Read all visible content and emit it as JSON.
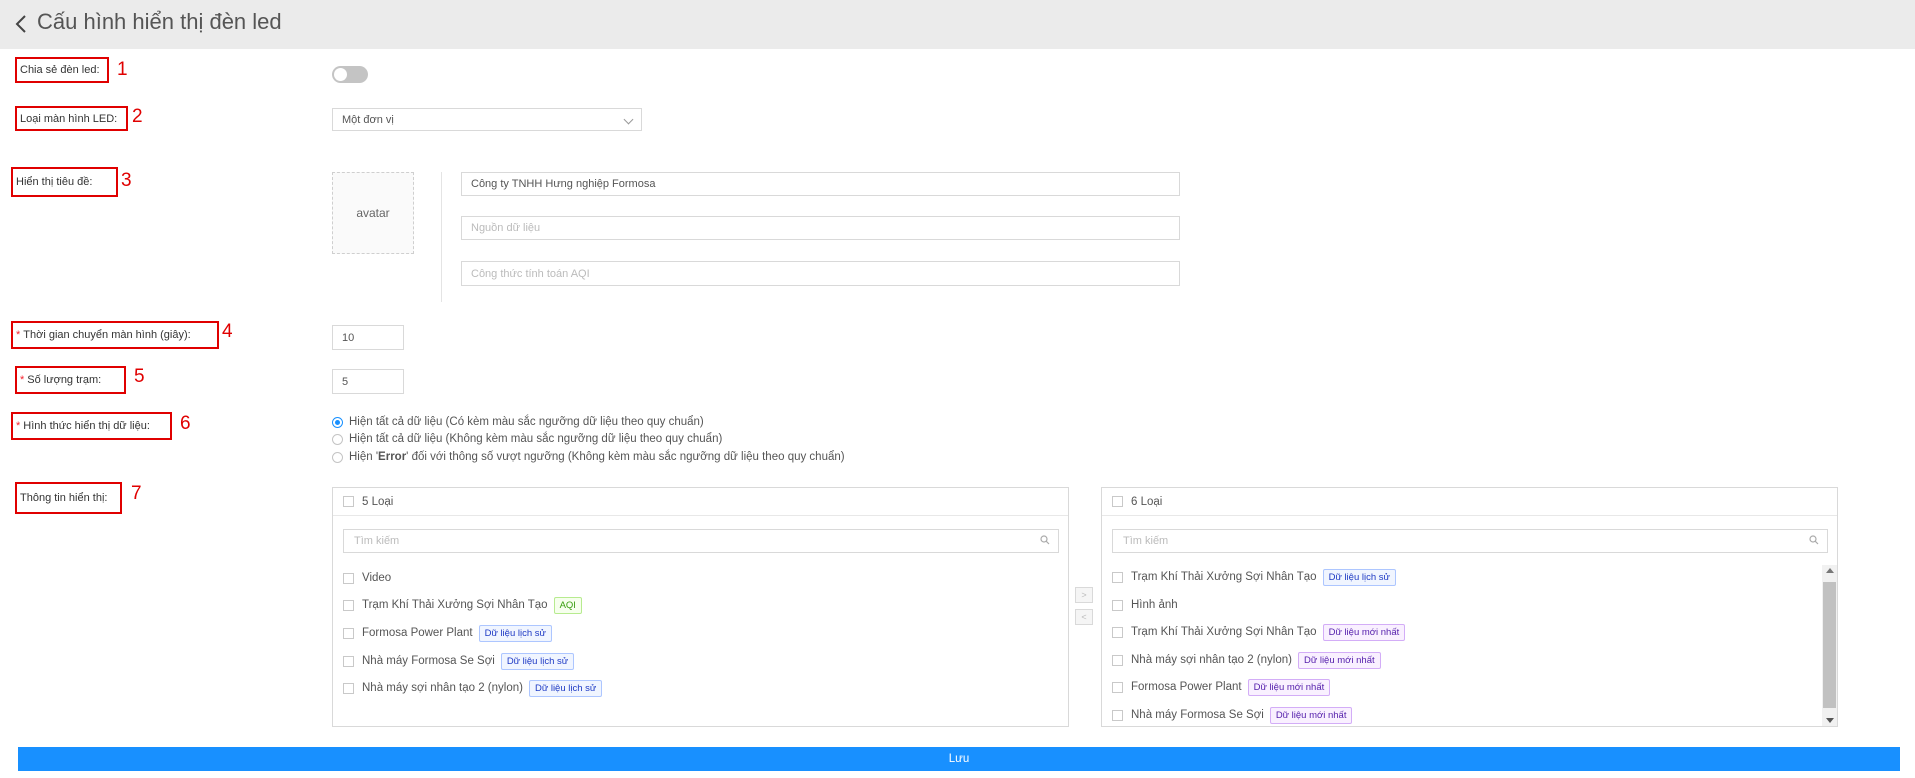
{
  "header": {
    "title": "Cấu hình hiển thị đèn led"
  },
  "form": {
    "share_led": {
      "label": "Chia sẻ đèn led",
      "number": "1",
      "enabled": false
    },
    "screen_type": {
      "label": "Loại màn hình LED",
      "number": "2",
      "value": "Một đơn vị"
    },
    "show_title": {
      "label": "Hiển thị tiêu đề",
      "number": "3",
      "avatar_alt": "avatar",
      "company_value": "Công ty TNHH Hưng nghiệp Formosa",
      "source_placeholder": "Nguồn dữ liệu",
      "aqi_placeholder": "Công thức tính toán AQI"
    },
    "switch_time": {
      "label": "Thời gian chuyển màn hình (giây)",
      "number": "4",
      "required": "*",
      "value": "10"
    },
    "station_count": {
      "label": "Số lượng trạm",
      "number": "5",
      "required": "*",
      "value": "5"
    },
    "display_mode": {
      "label": "Hình thức hiển thị dữ liệu",
      "number": "6",
      "required": "*",
      "options": [
        {
          "text": "Hiện tất cả dữ liệu (Có kèm màu sắc ngưỡng dữ liệu theo quy chuẩn)",
          "selected": true
        },
        {
          "text": "Hiện tất cả dữ liệu (Không kèm màu sắc ngưỡng dữ liệu theo quy chuẩn)",
          "selected": false
        },
        {
          "pre": "Hiện '",
          "bold": "Error",
          "post": "' đối với thông số vượt ngưỡng (Không kèm màu sắc ngưỡng dữ liệu theo quy chuẩn)",
          "selected": false
        }
      ]
    },
    "display_info": {
      "label": "Thông tin hiển thị",
      "number": "7"
    },
    "colon": ":"
  },
  "transfer": {
    "left": {
      "title": "5 Loại",
      "search_placeholder": "Tìm kiếm",
      "items": [
        {
          "name": "Video",
          "tag": ""
        },
        {
          "name": "Trạm Khí Thải Xưởng Sợi Nhân Tạo",
          "tag": "AQI",
          "tag_color": "green"
        },
        {
          "name": "Formosa Power Plant",
          "tag": "Dữ liệu lịch sử",
          "tag_color": "blue"
        },
        {
          "name": "Nhà máy Formosa Se Sợi",
          "tag": "Dữ liệu lịch sử",
          "tag_color": "blue"
        },
        {
          "name": "Nhà máy sợi nhân tạo 2 (nylon)",
          "tag": "Dữ liệu lịch sử",
          "tag_color": "blue"
        }
      ]
    },
    "right": {
      "title": "6 Loại",
      "search_placeholder": "Tìm kiếm",
      "items": [
        {
          "name": "Trạm Khí Thải Xưởng Sợi Nhân Tạo",
          "tag": "Dữ liệu lịch sử",
          "tag_color": "blue"
        },
        {
          "name": "Hình ảnh",
          "tag": ""
        },
        {
          "name": "Trạm Khí Thải Xưởng Sợi Nhân Tạo",
          "tag": "Dữ liệu mới nhất",
          "tag_color": "purple"
        },
        {
          "name": "Nhà máy sợi nhân tạo 2 (nylon)",
          "tag": "Dữ liệu mới nhất",
          "tag_color": "purple"
        },
        {
          "name": "Formosa Power Plant",
          "tag": "Dữ liệu mới nhất",
          "tag_color": "purple"
        },
        {
          "name": "Nhà máy Formosa Se Sợi",
          "tag": "Dữ liệu mới nhất",
          "tag_color": "purple"
        }
      ]
    },
    "move_right_glyph": ">",
    "move_left_glyph": "<"
  },
  "save_label": "Lưu",
  "colors": {
    "primary": "#1890ff",
    "annotation": "#e00000",
    "required": "#f5222d",
    "header_bg": "#ebebeb"
  },
  "icons": [
    "back-chevron-icon",
    "chevron-down-icon",
    "search-icon",
    "scroll-up-icon",
    "scroll-down-icon"
  ]
}
